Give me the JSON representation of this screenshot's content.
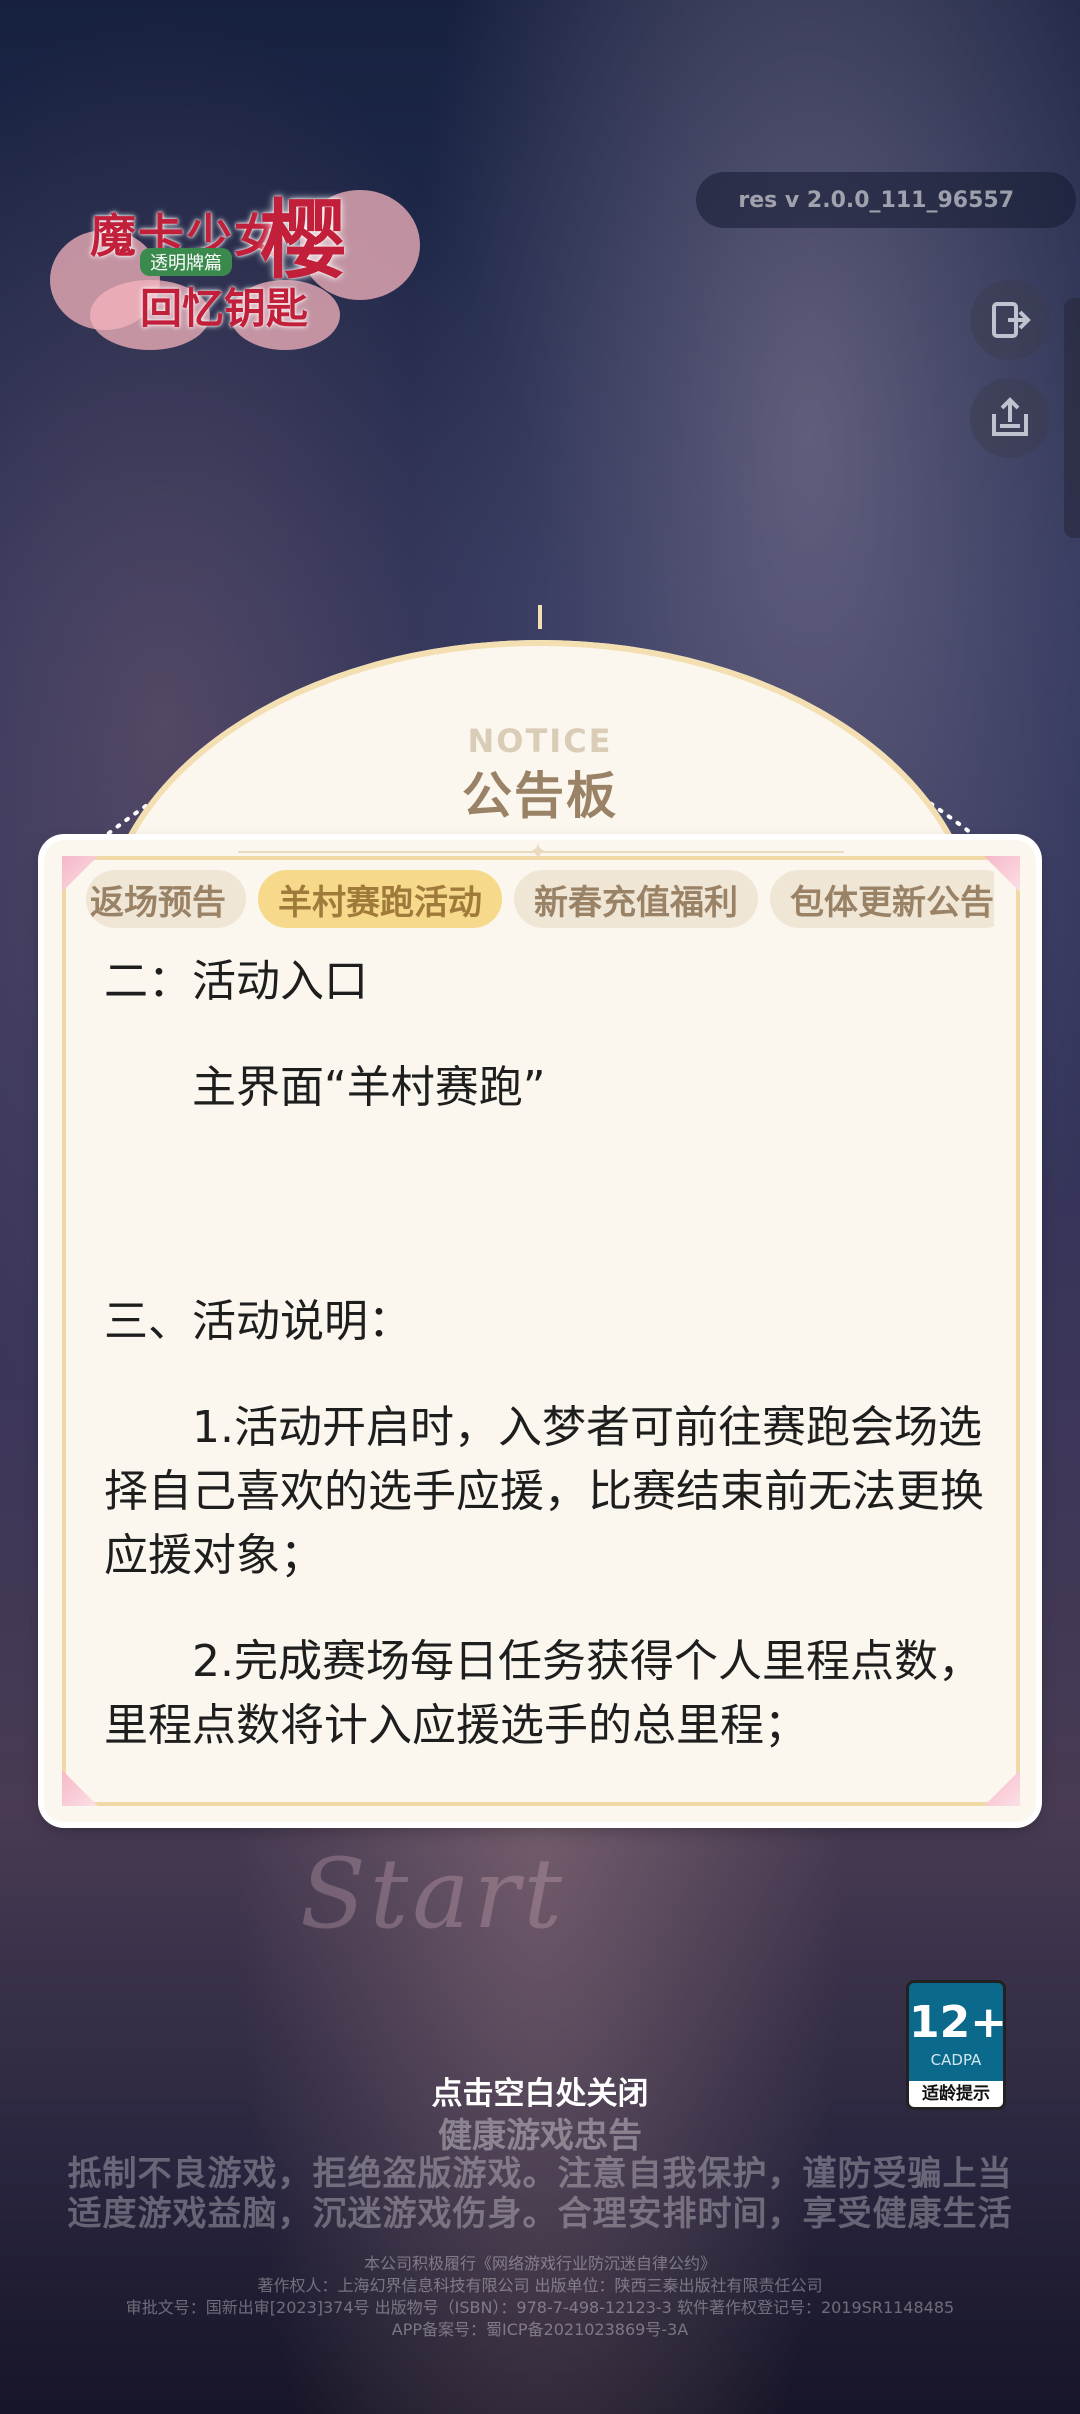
{
  "app": {
    "logo": {
      "line1": "魔卡少女",
      "big_char": "樱",
      "tagline": "透明牌篇",
      "line2": "回忆钥匙"
    },
    "version": "res v 2.0.0_111_96557",
    "side_buttons": [
      "logout-icon",
      "upload-icon"
    ]
  },
  "notice": {
    "label_en": "NOTICE",
    "title": "公告板",
    "tabs": [
      {
        "label": "返场预告",
        "active": false
      },
      {
        "label": "羊村赛跑活动",
        "active": true
      },
      {
        "label": "新春充值福利",
        "active": false
      },
      {
        "label": "包体更新公告",
        "active": false
      }
    ],
    "content": {
      "section2_heading": "二：活动入口",
      "section2_body": "主界面“羊村赛跑”",
      "section3_heading": "三、活动说明：",
      "item1": "1.活动开启时，入梦者可前往赛跑会场选择自己喜欢的选手应援，比赛结束前无法更换应援对象；",
      "item2": "2.完成赛场每日任务获得个人里程点数，里程点数将计入应援选手的总里程；"
    }
  },
  "footer": {
    "close_hint": "点击空白处关闭",
    "health_title": "健康游戏忠告",
    "health_line1": "抵制不良游戏，拒绝盗版游戏。注意自我保护，谨防受骗上当",
    "health_line2": "适度游戏益脑，沉迷游戏伤身。合理安排时间，享受健康生活",
    "legal1": "本公司积极履行《网络游戏行业防沉迷自律公约》",
    "legal2": "著作权人：上海幻界信息科技有限公司  出版单位：陕西三秦出版社有限责任公司",
    "legal3": "审批文号：国新出审[2023]374号  出版物号（ISBN）：978-7-498-12123-3  软件著作权登记号：2019SR1148485",
    "legal4": "APP备案号：蜀ICP备2021023869号-3A"
  },
  "age_rating": {
    "number": "12+",
    "org": "CADPA",
    "label": "适龄提示"
  },
  "colors": {
    "panel_bg": "#fbf7ef",
    "tab_active": "#f6d98a",
    "tab_inactive": "#efe6d6",
    "title_brown": "#9a8266"
  }
}
